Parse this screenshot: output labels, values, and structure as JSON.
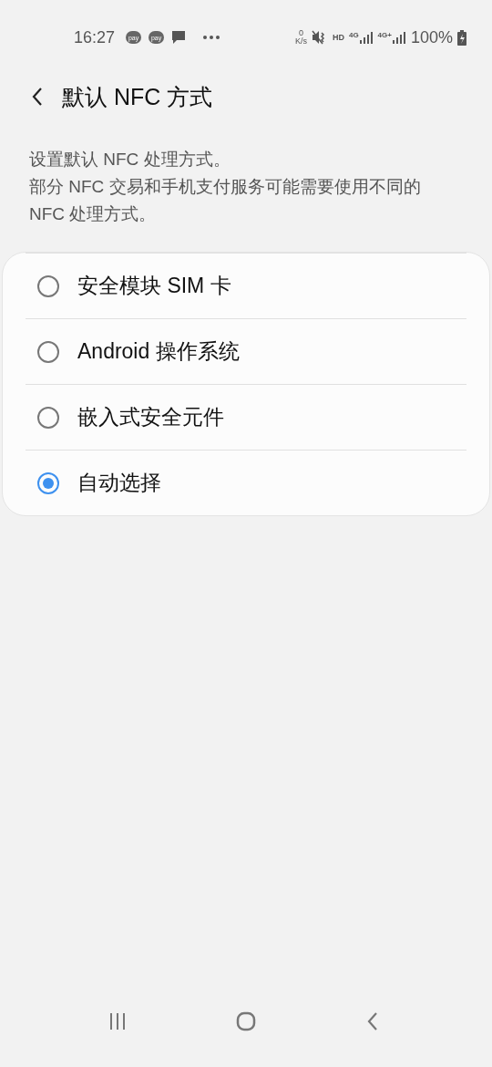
{
  "status_bar": {
    "time": "16:27",
    "notifications": [
      {
        "kind": "pay",
        "label": "pay"
      },
      {
        "kind": "pay",
        "label": "pay"
      },
      {
        "kind": "message"
      },
      {
        "kind": "more"
      }
    ],
    "speed_value": "0",
    "speed_unit": "K/s",
    "hd": "HD",
    "network_1": "4G",
    "network_2": "4G+",
    "battery": "100%"
  },
  "header": {
    "title": "默认 NFC 方式"
  },
  "description": [
    "设置默认 NFC 处理方式。",
    "部分 NFC 交易和手机支付服务可能需要使用不同的 NFC 处理方式。"
  ],
  "options": [
    {
      "label": "安全模块 SIM 卡",
      "selected": false
    },
    {
      "label": "Android 操作系统",
      "selected": false
    },
    {
      "label": "嵌入式安全元件",
      "selected": false
    },
    {
      "label": "自动选择",
      "selected": true
    }
  ]
}
